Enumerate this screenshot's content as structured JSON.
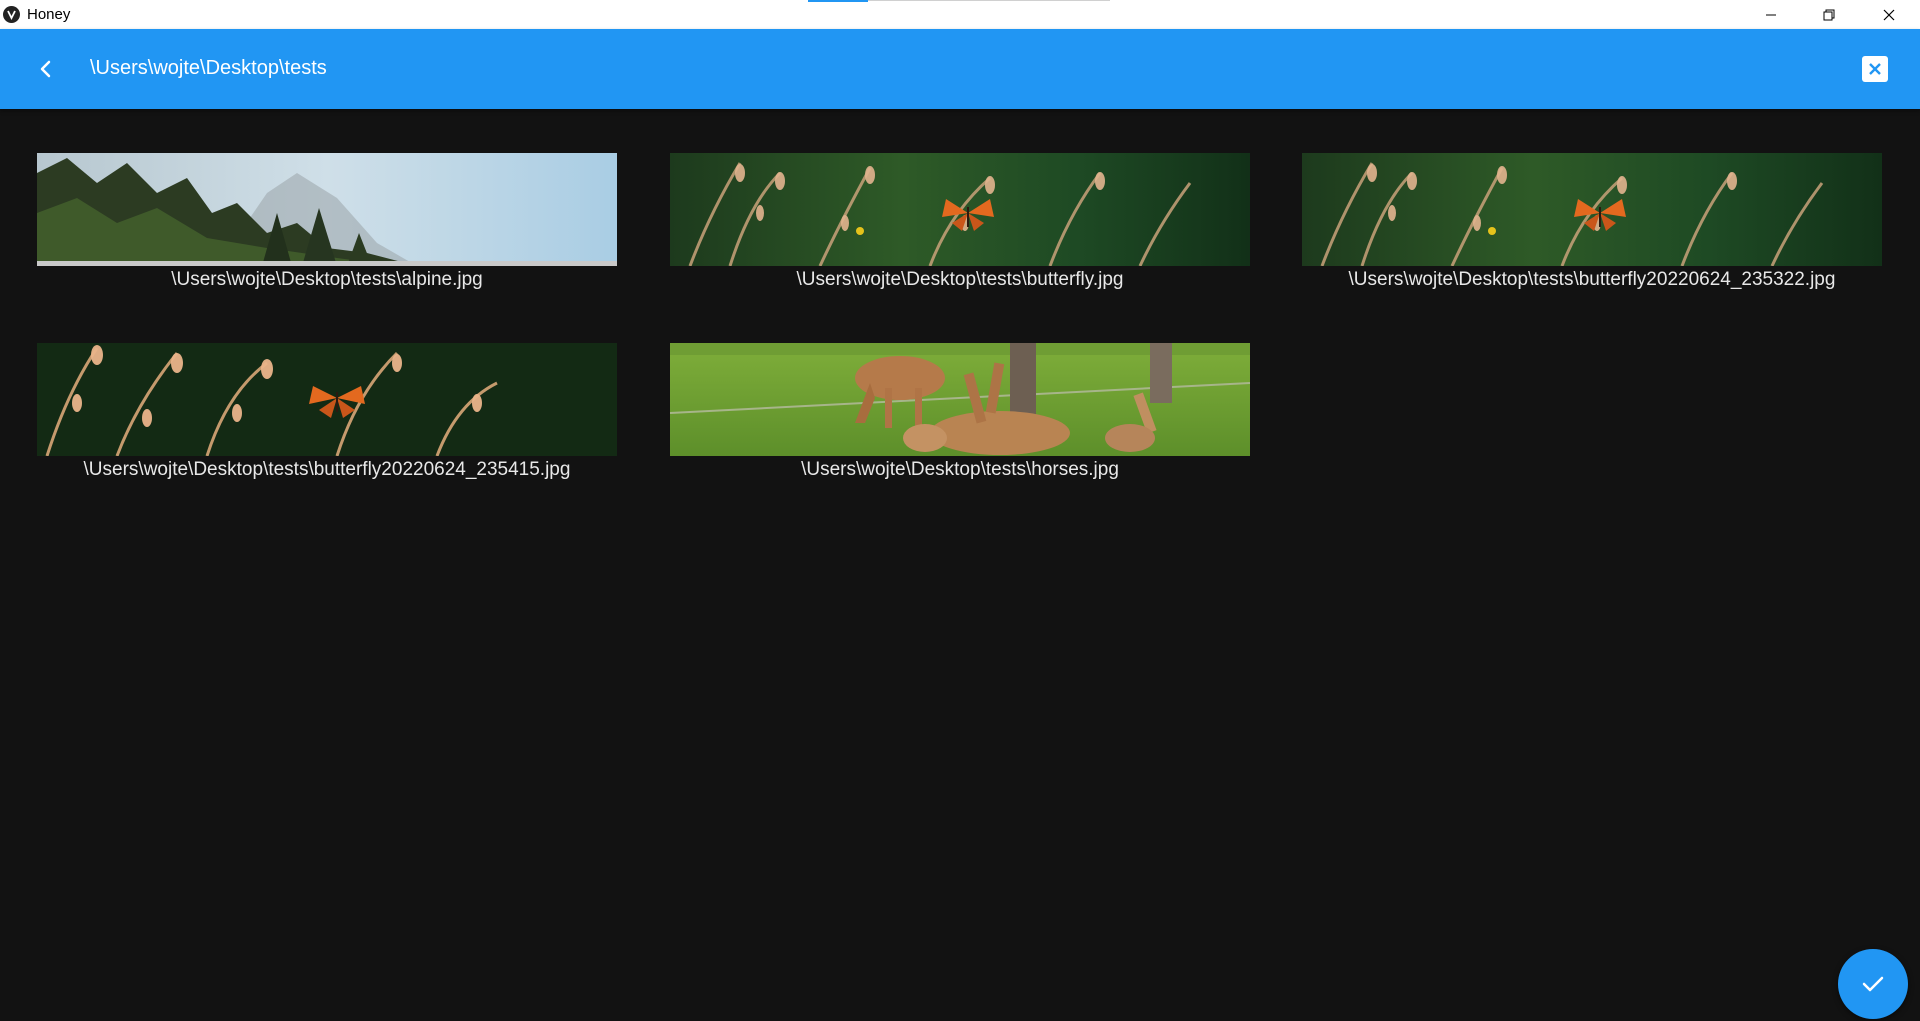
{
  "window": {
    "title": "Honey",
    "icons": {
      "app": "honey-app-icon",
      "minimize": "minimize-icon",
      "maximize": "restore-icon",
      "close": "close-icon"
    }
  },
  "appbar": {
    "path": "\\Users\\wojte\\Desktop\\tests",
    "back_icon": "chevron-left-icon",
    "close_icon": "close-box-icon",
    "color": "#2196f3"
  },
  "files": [
    {
      "name": "\\Users\\wojte\\Desktop\\tests\\alpine.jpg",
      "thumb": "alpine-forest"
    },
    {
      "name": "\\Users\\wojte\\Desktop\\tests\\butterfly.jpg",
      "thumb": "butterfly-grass"
    },
    {
      "name": "\\Users\\wojte\\Desktop\\tests\\butterfly20220624_235322.jpg",
      "thumb": "butterfly-grass"
    },
    {
      "name": "\\Users\\wojte\\Desktop\\tests\\butterfly20220624_235415.jpg",
      "thumb": "butterfly-grass"
    },
    {
      "name": "\\Users\\wojte\\Desktop\\tests\\horses.jpg",
      "thumb": "horses-meadow"
    }
  ],
  "fab": {
    "icon": "check-icon",
    "color": "#2196f3"
  },
  "background": "#121212"
}
